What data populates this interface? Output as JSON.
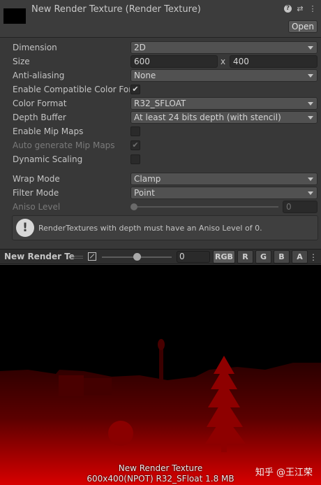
{
  "header": {
    "title": "New Render Texture (Render Texture)",
    "open_label": "Open",
    "icons": [
      "help-icon",
      "preset-icon",
      "menu-icon"
    ]
  },
  "fields": {
    "dimension": {
      "label": "Dimension",
      "value": "2D"
    },
    "size": {
      "label": "Size",
      "width": "600",
      "sep": "x",
      "height": "400"
    },
    "anti_aliasing": {
      "label": "Anti-aliasing",
      "value": "None"
    },
    "compatible": {
      "label": "Enable Compatible Color Format",
      "checked": "✔"
    },
    "color_format": {
      "label": "Color Format",
      "value": "R32_SFLOAT"
    },
    "depth_buffer": {
      "label": "Depth Buffer",
      "value": "At least 24 bits depth (with stencil)"
    },
    "mip_maps": {
      "label": "Enable Mip Maps",
      "checked": ""
    },
    "auto_mips": {
      "label": "Auto generate Mip Maps",
      "checked": "✔"
    },
    "dynamic_scaling": {
      "label": "Dynamic Scaling",
      "checked": ""
    },
    "wrap_mode": {
      "label": "Wrap Mode",
      "value": "Clamp"
    },
    "filter_mode": {
      "label": "Filter Mode",
      "value": "Point"
    },
    "aniso": {
      "label": "Aniso Level",
      "value": "0",
      "slider_fraction": 0
    }
  },
  "helpbox": {
    "icon": "warning-icon",
    "text": "RenderTextures with depth must have an Aniso Level of 0."
  },
  "preview_toolbar": {
    "title": "New Render Te",
    "mip_value": "0",
    "mip_slider_fraction": 0.5,
    "channels": [
      "RGB",
      "R",
      "G",
      "B",
      "A"
    ]
  },
  "preview": {
    "caption_name": "New Render Texture",
    "caption_info": "600x400(NPOT)  R32_SFloat  1.8 MB",
    "watermark": "知乎 @王江荣",
    "accent": "#c00000"
  }
}
